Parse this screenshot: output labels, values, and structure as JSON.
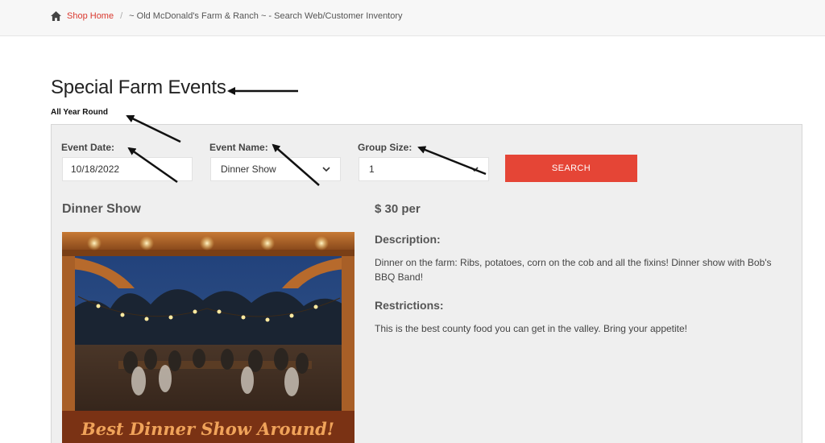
{
  "breadcrumb": {
    "home_label": "Shop Home",
    "separator": "/",
    "current": "~ Old McDonald's Farm & Ranch ~ - Search Web/Customer Inventory"
  },
  "page": {
    "title": "Special Farm Events",
    "subtitle": "All Year Round"
  },
  "search_form": {
    "date_label": "Event Date:",
    "date_value": "10/18/2022",
    "name_label": "Event Name:",
    "name_value": "Dinner Show",
    "group_label": "Group Size:",
    "group_value": "1",
    "search_label": "SEARCH"
  },
  "event": {
    "name": "Dinner Show",
    "price": "$ 30 per",
    "image_caption": "Best Dinner Show Around!",
    "description_heading": "Description:",
    "description": "Dinner on the farm: Ribs, potatoes, corn on the cob and all the fixins! Dinner show with Bob's BBQ Band!",
    "restrictions_heading": "Restrictions:",
    "restrictions": "This is the best county food you can get in the valley. Bring your appetite!"
  },
  "colors": {
    "accent": "#e54536",
    "link": "#d9382e",
    "panel_bg": "#efefef"
  },
  "icons": {
    "home": "home-icon",
    "dropdown": "chevron-down-icon"
  }
}
